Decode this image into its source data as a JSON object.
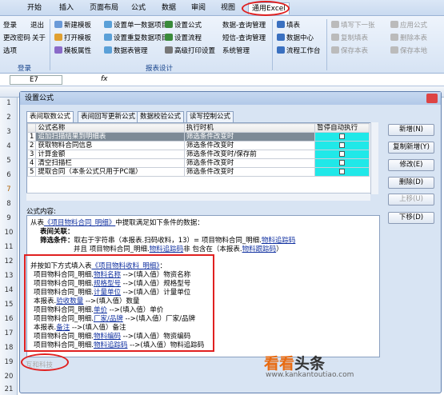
{
  "ribbon_tabs": [
    "开始",
    "插入",
    "页面布局",
    "公式",
    "数据",
    "审阅",
    "视图",
    "通用Excel"
  ],
  "ribbon": {
    "group1": {
      "items": [
        "登录",
        "退出",
        "更改密码",
        "关于",
        "选项"
      ],
      "label": "登录"
    },
    "group2": {
      "items": [
        "新建模板",
        "打开模板",
        "模板属性",
        "设置单一数据项目",
        "设置重复数据项目",
        "数据表管理",
        "设置公式",
        "设置流程",
        "高级打印设置",
        "数据-查询管理",
        "短信-查询管理",
        "系统管理"
      ],
      "label": "报表设计"
    },
    "group3": {
      "items": [
        "填表",
        "数据中心",
        "流程工作台"
      ]
    },
    "group4": {
      "items": [
        "填写下一张",
        "复制填表",
        "保存本表",
        "应用公式",
        "删除本表",
        "保存本地"
      ]
    }
  },
  "formula_bar": {
    "cell": "E7",
    "fx": "fx"
  },
  "row_numbers": [
    "1",
    "2",
    "3",
    "4",
    "5",
    "6",
    "7",
    "8",
    "9",
    "10",
    "11",
    "12",
    "13",
    "14",
    "15",
    "16",
    "17",
    "18",
    "19",
    "20",
    "21"
  ],
  "dialog": {
    "title": "设置公式",
    "tabs": [
      "表间取数公式",
      "表间回写更新公式",
      "数据校验公式",
      "读写控制公式"
    ],
    "table": {
      "headers": [
        "公式名称",
        "执行时机",
        "暂停自动执行"
      ],
      "rows": [
        {
          "num": "1",
          "name": "追加扫描结果到明细表",
          "timing": "筛选条件改变时"
        },
        {
          "num": "2",
          "name": "获取物料合同信息",
          "timing": "筛选条件改变时"
        },
        {
          "num": "3",
          "name": "计算金额",
          "timing": "筛选条件改变时/保存前"
        },
        {
          "num": "4",
          "name": "清空扫描栏",
          "timing": "筛选条件改变时"
        },
        {
          "num": "5",
          "name": "提取合同（本条公式只用于PC端）",
          "timing": "筛选条件改变时"
        }
      ]
    },
    "buttons": [
      "新增(N)",
      "复制新增(Y)",
      "修改(E)",
      "删除(D)",
      "上移(U)",
      "下移(D)"
    ],
    "content_label": "公式内容:",
    "content": {
      "l1a": "从表",
      "l1b": "《项目物料合同_明细》",
      "l1c": "中提取满足如下条件的数据：",
      "l2": "表间关联：",
      "l3a": "筛选条件：",
      "l3b": "取右于字符串（本报表.扫码收料，13）= 项目物料合同_明细.",
      "l3c": "物料追踪码",
      "l4a": "并且 项目物料合同_明细.",
      "l4b": "物料追踪码",
      "l4c": "非 包含在（本报表.",
      "l4d": "物料跟踪码",
      "l4e": "）",
      "l5a": "并按如下方式填入表",
      "l5b": "《项目物料收料_明细》",
      ":": "：",
      "l6a": "项目物料合同_明细.",
      "l6b": "物料名称",
      "l6c": "-->(填入值）物资名称",
      "l7a": "项目物料合同_明细.",
      "l7b": "规格型号",
      "l7c": "-->(填入值）规格型号",
      "l8a": "项目物料合同_明细.",
      "l8b": "计量单位",
      "l8c": "-->(填入值）计量单位",
      "l9a": "本报表.",
      "l9b": "验收数量",
      "l9c": "-->(填入值）数量",
      "l10a": "项目物料合同_明细.",
      "l10b": "单价",
      "l10c": "-->(填入值）单价",
      "l11a": "项目物料合同_明细.",
      "l11b": "厂家/品牌",
      "l11c": "-->(填入值）厂家/品牌",
      "l12a": "本报表.",
      "l12b": "备注",
      "l12c": "-->(填入值）备注",
      "l13a": "项目物料合同_明细.",
      "l13b": "物料编码",
      "l13c": "-->(填入值）物资编码",
      "l14a": "项目物料合同_明细.",
      "l14b": "物料追踪码",
      "l14c": "-->(填入值）物料追踪码"
    }
  },
  "footer_text": "互和科技",
  "watermark": {
    "main": "看看",
    "sub": "头条",
    "url": "www.kankantoutiao.com"
  }
}
